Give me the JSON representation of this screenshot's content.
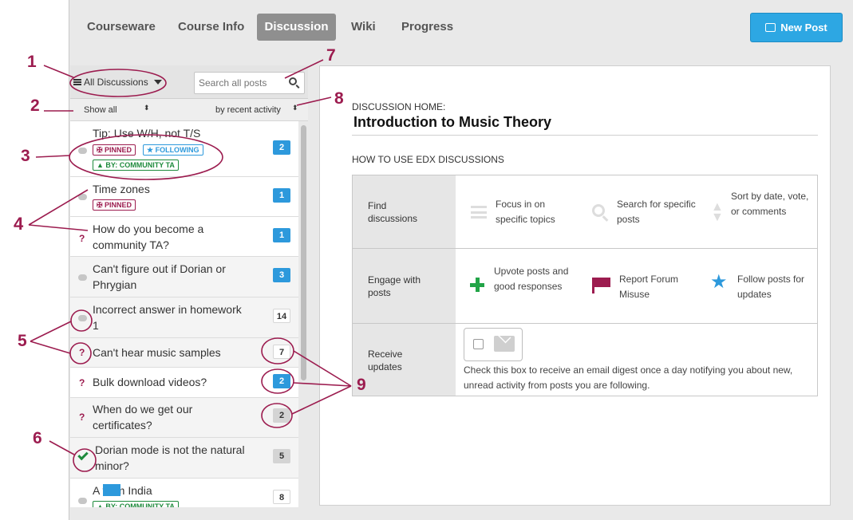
{
  "nav": {
    "tabs": [
      "Courseware",
      "Course Info",
      "Discussion",
      "Wiki",
      "Progress"
    ],
    "active_tab": "Discussion",
    "new_post_label": "New Post"
  },
  "sidebar": {
    "all_discussions_label": "All Discussions",
    "search_placeholder": "Search all posts",
    "filter_label": "Show all",
    "sort_label": "by recent activity"
  },
  "threads": [
    {
      "title": "Tip: Use W/H, not T/S",
      "type": "discussion",
      "count": "2",
      "count_style": "blue",
      "tags": [
        "PINNED",
        "FOLLOWING",
        "BY: COMMUNITY TA"
      ]
    },
    {
      "title": "Time zones",
      "type": "discussion",
      "count": "1",
      "count_style": "blue",
      "tags": [
        "PINNED"
      ]
    },
    {
      "title": "How do you become a community TA?",
      "type": "question",
      "count": "1",
      "count_style": "blue",
      "tags": []
    },
    {
      "title": "Can't figure out if Dorian or Phrygian",
      "type": "discussion",
      "count": "3",
      "count_style": "blue",
      "tags": []
    },
    {
      "title": "Incorrect answer in homework 1",
      "type": "discussion",
      "count": "14",
      "count_style": "white",
      "tags": []
    },
    {
      "title": "Can't hear music samples",
      "type": "question",
      "count": "7",
      "count_style": "white",
      "tags": []
    },
    {
      "title": "Bulk download videos?",
      "type": "question",
      "count": "2",
      "count_style": "blue",
      "tags": []
    },
    {
      "title": "When do we get our certificates?",
      "type": "question",
      "count": "2",
      "count_style": "gray",
      "tags": []
    },
    {
      "title": "Dorian mode is not the natural minor?",
      "type": "answered",
      "count": "5",
      "count_style": "gray",
      "tags": []
    },
    {
      "title": "A from India",
      "type": "discussion",
      "count": "8",
      "count_style": "white",
      "tags": [
        "BY: COMMUNITY TA"
      ]
    }
  ],
  "main": {
    "home_label": "DISCUSSION HOME:",
    "course_title": "Introduction to Music Theory",
    "howto_title": "HOW TO USE EDX DISCUSSIONS",
    "rows": [
      {
        "heading": "Find discussions",
        "features": [
          {
            "icon": "list-icon",
            "text": "Focus in on specific topics"
          },
          {
            "icon": "search-icon",
            "text": "Search for specific posts"
          },
          {
            "icon": "sort-icon",
            "text": "Sort by date, vote, or comments"
          }
        ]
      },
      {
        "heading": "Engage with posts",
        "features": [
          {
            "icon": "plus-icon",
            "text": "Upvote posts and good responses"
          },
          {
            "icon": "flag-icon",
            "text": "Report Forum Misuse"
          },
          {
            "icon": "star-icon",
            "text": "Follow posts for updates"
          }
        ]
      },
      {
        "heading": "Receive updates",
        "features": [
          {
            "icon": "envelope-icon",
            "text": "Check this box to receive an email digest once a day notifying you about new, unread activity from posts you are following."
          }
        ]
      }
    ]
  },
  "annotations": [
    "1",
    "2",
    "3",
    "4",
    "5",
    "6",
    "7",
    "8",
    "9"
  ],
  "colors": {
    "accent": "#9c1c4f",
    "primary_blue": "#2d99dc",
    "success_green": "#1e8a3c"
  }
}
